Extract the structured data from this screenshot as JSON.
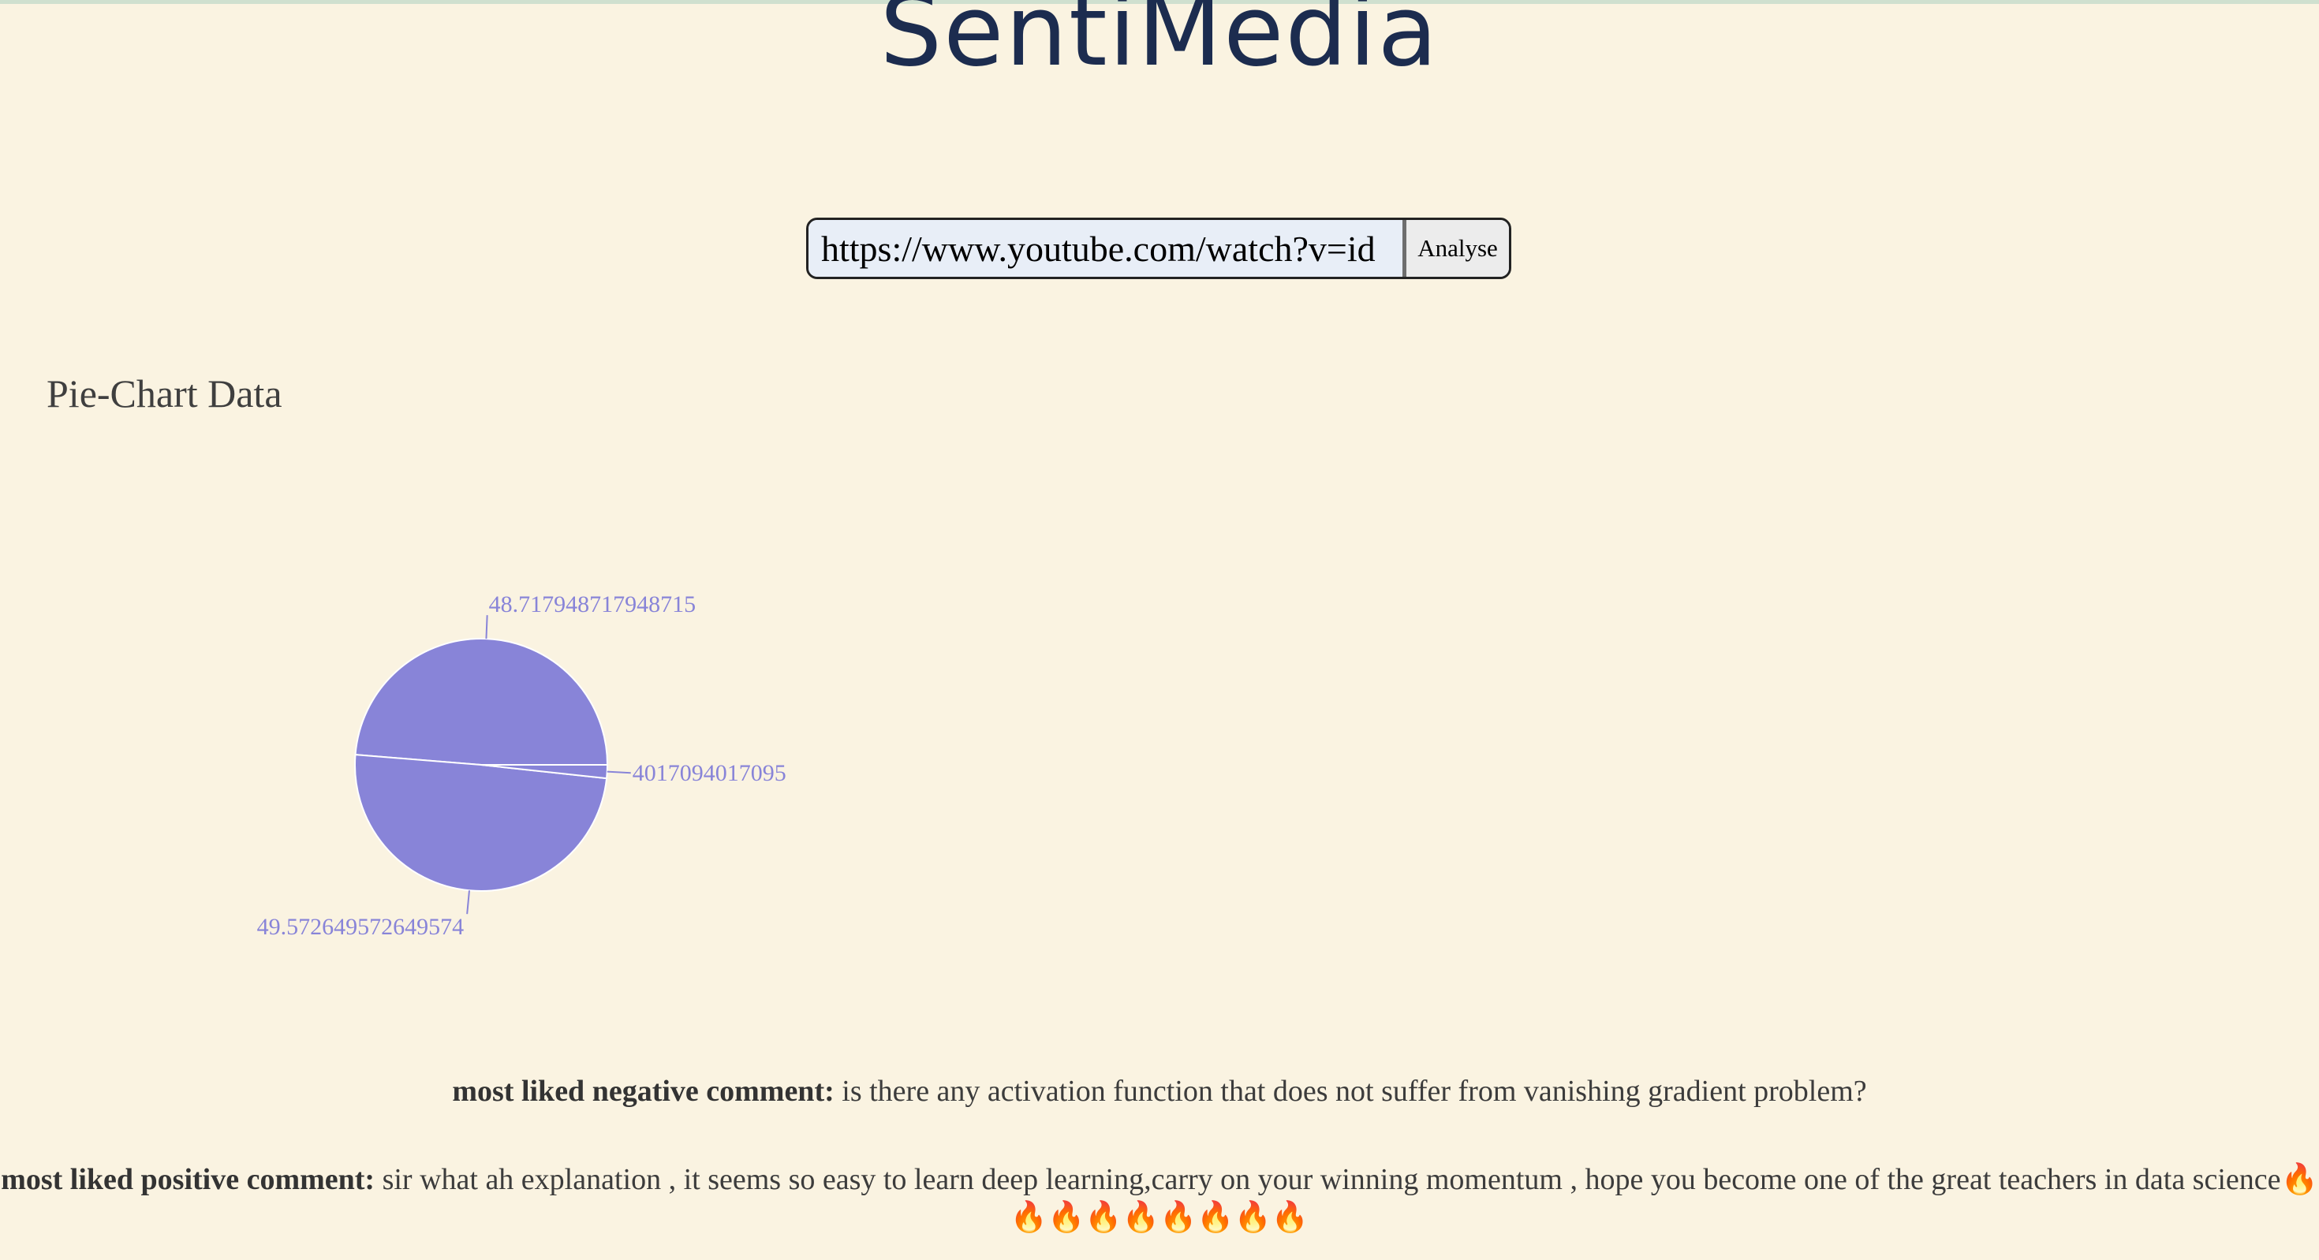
{
  "app": {
    "logo": "SentiMedia"
  },
  "search": {
    "value": "https://www.youtube.com/watch?v=id",
    "button_label": "Analyse"
  },
  "section": {
    "title": "Pie-Chart Data"
  },
  "chart_data": {
    "type": "pie",
    "title": "",
    "values": [
      48.717948717948715,
      49.572649572649574,
      1.7094017094017095
    ],
    "labels": [
      "48.717948717948715",
      "49.572649572649574",
      "4017094017095"
    ],
    "color": "#8884d8",
    "label_color": "#8884d8",
    "stroke": "#ffffff"
  },
  "comments": {
    "negative_label": "most liked negative comment:",
    "negative_text": " is there any activation function that does not suffer from vanishing gradient problem?",
    "positive_label": "most liked positive comment:",
    "positive_text": " sir what ah explanation , it seems so easy to learn deep learning,carry on your winning momentum , hope you become one of the great teachers in data science🔥🔥🔥🔥🔥🔥🔥🔥🔥"
  }
}
